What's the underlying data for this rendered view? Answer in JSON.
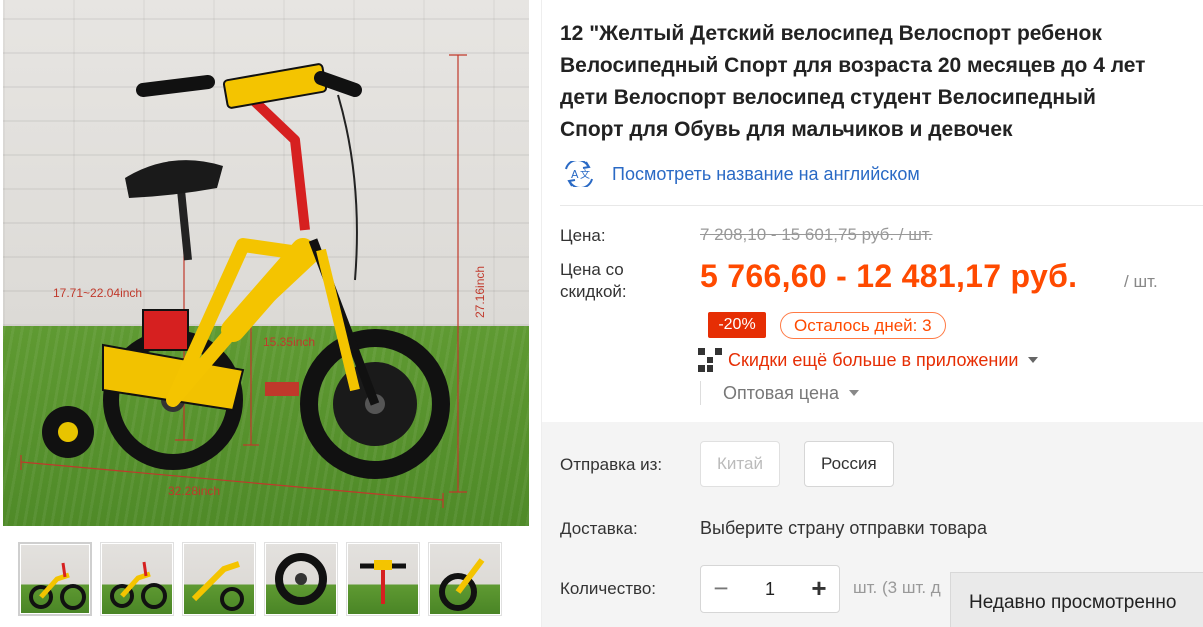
{
  "product": {
    "title_lines": [
      "12 \"Желтый Детский велосипед Велоспорт ребенок",
      "Велосипедный Спорт для возраста 20 месяцев до 4 лет",
      "дети Велоспорт велосипед студент Велосипедный",
      "Спорт для Обувь для мальчиков и девочек"
    ],
    "translate_link": "Посмотреть название на английском"
  },
  "gallery": {
    "dimension_labels": {
      "handle_height": "17.71~22.04inch",
      "seat_height": "15.35inch",
      "total_height": "27.16inch",
      "length": "32.28inch"
    },
    "thumbnail_count": 6
  },
  "price": {
    "label": "Цена:",
    "original": "7 208,10 - 15 601,75 руб. / шт.",
    "discount_label": "Цена со скидкой:",
    "discounted": "5 766,60 - 12 481,17 руб.",
    "unit": "/ шт.",
    "discount_badge": "-20%",
    "days_left": "Осталось дней: 3",
    "app_promo": "Скидки ещё больше в приложении",
    "wholesale": "Оптовая цена"
  },
  "shipping": {
    "from_label": "Отправка из:",
    "options": [
      "Китай",
      "Россия"
    ],
    "delivery_label": "Доставка:",
    "delivery_text": "Выберите страну отправки товара"
  },
  "quantity": {
    "label": "Количество:",
    "value": "1",
    "minus": "−",
    "plus": "+",
    "unit_text": "шт. (3 шт. д"
  },
  "recently_viewed": "Недавно просмотренно",
  "colors": {
    "price_accent": "#ff4a00",
    "badge_red": "#e62e04",
    "link_blue": "#2a6ac5"
  }
}
